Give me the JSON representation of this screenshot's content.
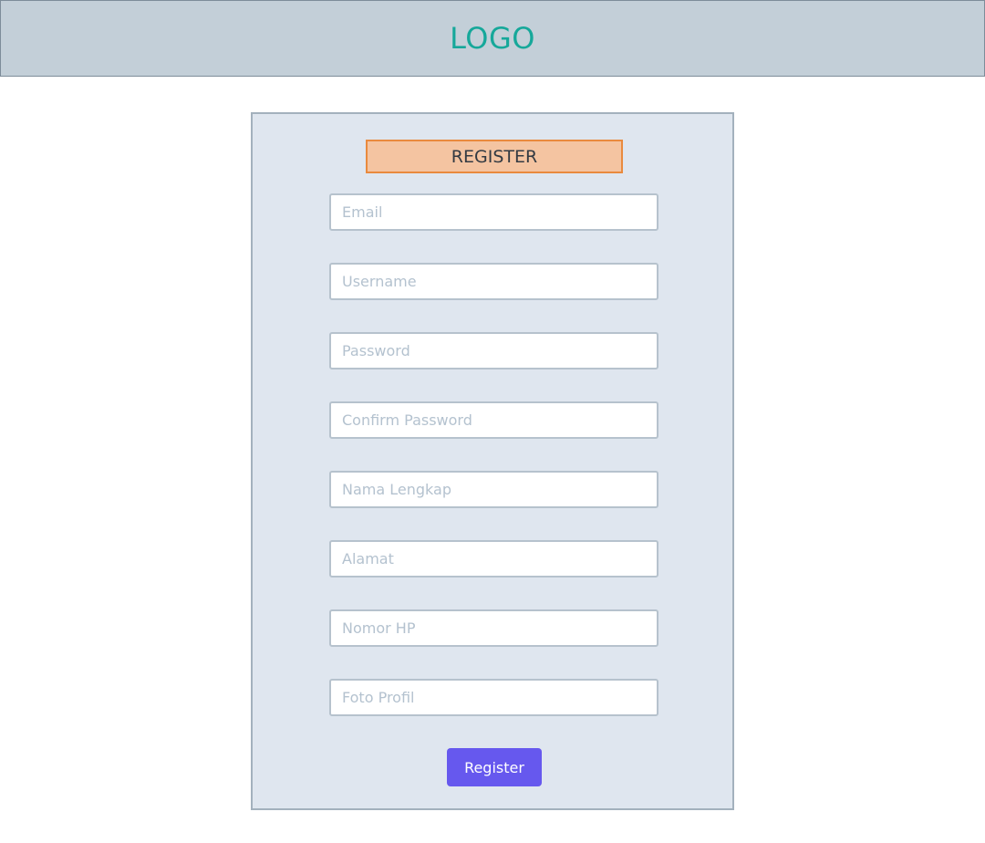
{
  "header": {
    "logo": "LOGO"
  },
  "form": {
    "title": "REGISTER",
    "fields": [
      {
        "placeholder": "Email",
        "value": ""
      },
      {
        "placeholder": "Username",
        "value": ""
      },
      {
        "placeholder": "Password",
        "value": ""
      },
      {
        "placeholder": "Confirm Password",
        "value": ""
      },
      {
        "placeholder": "Nama Lengkap",
        "value": ""
      },
      {
        "placeholder": "Alamat",
        "value": ""
      },
      {
        "placeholder": "Nomor HP",
        "value": ""
      },
      {
        "placeholder": "Foto Profil",
        "value": ""
      }
    ],
    "submit_label": "Register"
  },
  "colors": {
    "header_bg": "#c3cfd8",
    "logo": "#16a89a",
    "card_bg": "#dfe6ef",
    "title_bg": "#f4c4a1",
    "title_border": "#e98a3e",
    "button": "#6658ee"
  }
}
